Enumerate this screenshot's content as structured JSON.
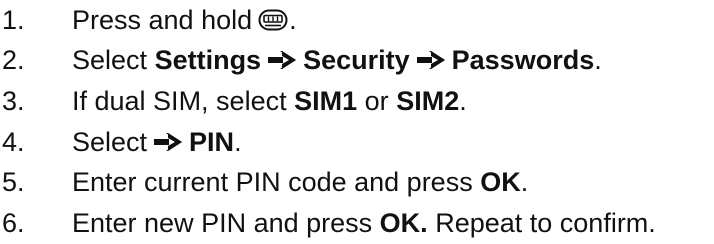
{
  "steps": [
    {
      "number": "1.",
      "text_a": "Press and hold",
      "icon": "menu-key-icon",
      "text_b": "."
    },
    {
      "number": "2.",
      "text_a": "Select",
      "bold_a": "Settings",
      "bold_b": "Security",
      "bold_c": "Passwords",
      "text_b": "."
    },
    {
      "number": "3.",
      "text_a": "If dual SIM, select",
      "bold_a": "SIM1",
      "text_b": "or",
      "bold_b": "SIM2",
      "text_c": "."
    },
    {
      "number": "4.",
      "text_a": "Select",
      "bold_a": "PIN",
      "text_b": "."
    },
    {
      "number": "5.",
      "text_a": "Enter current PIN code and press",
      "bold_a": "OK",
      "text_b": "."
    },
    {
      "number": "6.",
      "text_a": "Enter new PIN and press",
      "bold_a": "OK.",
      "text_b": "Repeat to confirm."
    }
  ]
}
